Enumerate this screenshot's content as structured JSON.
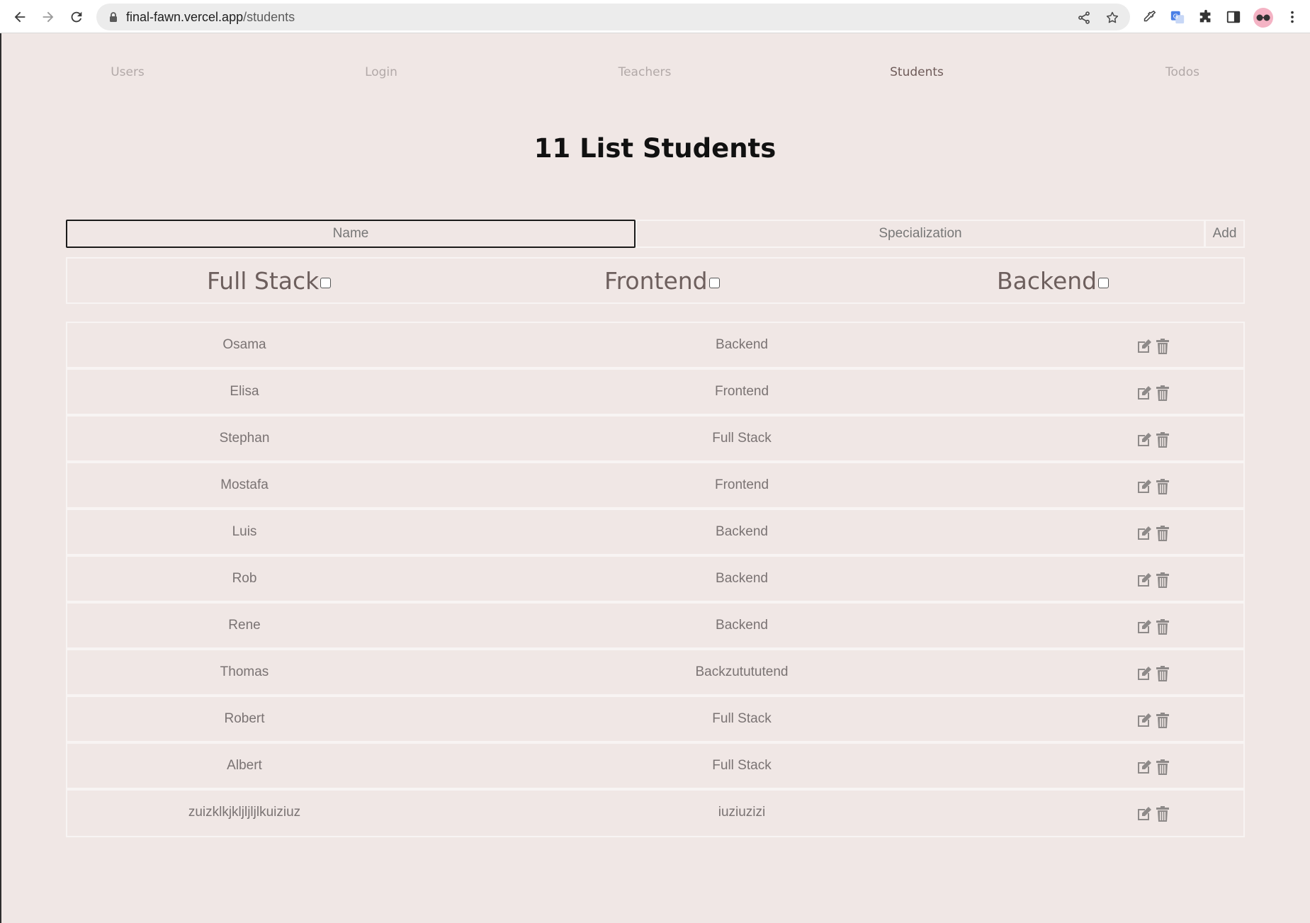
{
  "browser": {
    "url_host": "final-fawn.vercel.app",
    "url_path": "/students"
  },
  "nav": {
    "items": [
      {
        "label": "Users"
      },
      {
        "label": "Login"
      },
      {
        "label": "Teachers"
      },
      {
        "label": "Students"
      },
      {
        "label": "Todos"
      }
    ],
    "active": "Students"
  },
  "title": "11 List Students",
  "form": {
    "name_placeholder": "Name",
    "spec_placeholder": "Specialization",
    "add_label": "Add"
  },
  "filters": [
    {
      "label": "Full Stack",
      "checked": false
    },
    {
      "label": "Frontend",
      "checked": false
    },
    {
      "label": "Backend",
      "checked": false
    }
  ],
  "students": [
    {
      "name": "Osama",
      "specialization": "Backend"
    },
    {
      "name": "Elisa",
      "specialization": "Frontend"
    },
    {
      "name": "Stephan",
      "specialization": "Full Stack"
    },
    {
      "name": "Mostafa",
      "specialization": "Frontend"
    },
    {
      "name": "Luis",
      "specialization": "Backend"
    },
    {
      "name": "Rob",
      "specialization": "Backend"
    },
    {
      "name": "Rene",
      "specialization": "Backend"
    },
    {
      "name": "Thomas",
      "specialization": "Backzutututend"
    },
    {
      "name": "Robert",
      "specialization": "Full Stack"
    },
    {
      "name": "Albert",
      "specialization": "Full Stack"
    },
    {
      "name": "zuizklkjkljljljlkuiziuz",
      "specialization": "iuziuzizi"
    }
  ],
  "icons": {
    "edit": "edit-icon",
    "delete": "trash-icon"
  },
  "colors": {
    "page_background": "#f0e7e5",
    "nav_inactive": "#b2a9a8",
    "nav_active": "#6e5b59",
    "cell_text": "#7a7373"
  }
}
